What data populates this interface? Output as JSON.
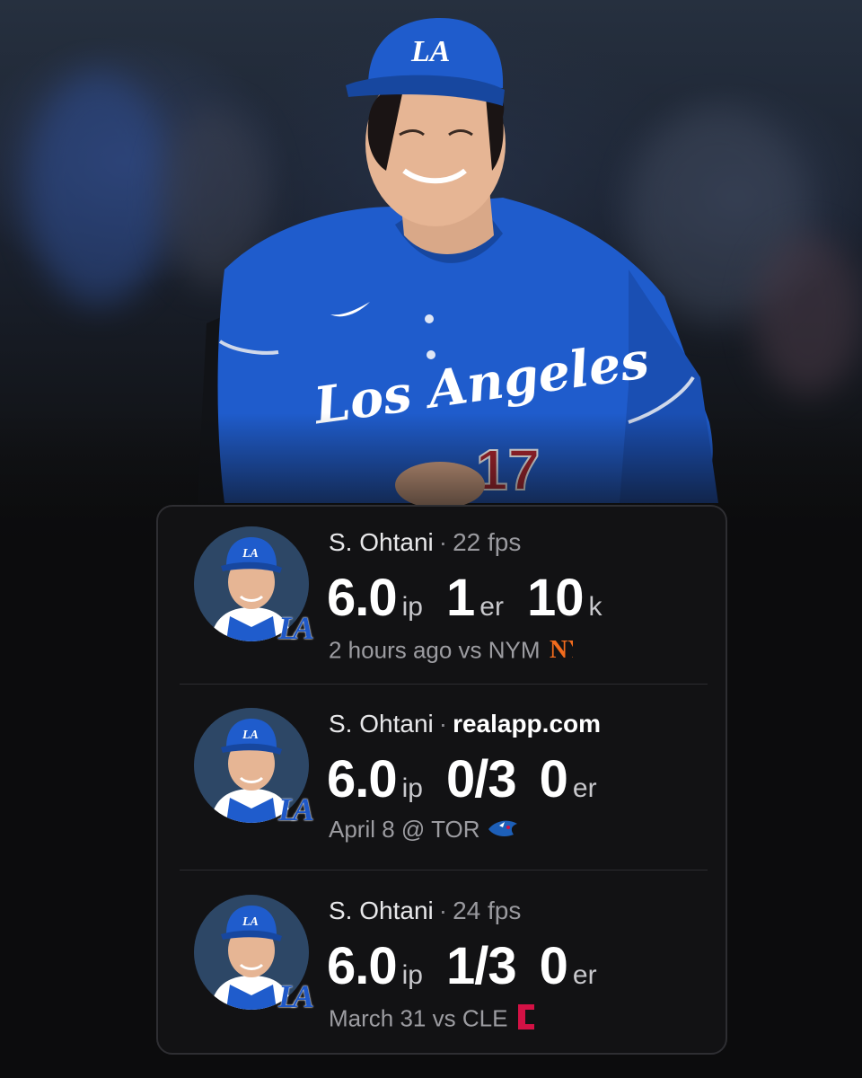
{
  "colors": {
    "dodger_blue": "#1f58c7",
    "card_bg": "#121214",
    "mets_orange": "#f26b1d",
    "guardians_red": "#d31145",
    "bluejays_blue": "#1d5fb8"
  },
  "hero": {
    "jersey_text": "Los Angeles",
    "jersey_number": "17",
    "cap_logo": "LA"
  },
  "games": [
    {
      "player": "S. Ohtani",
      "source": "22 fps",
      "source_style": "muted",
      "stats": [
        {
          "value": "6.0",
          "unit": "ip"
        },
        {
          "value": "1",
          "unit": "er"
        },
        {
          "value": "10",
          "unit": "k"
        }
      ],
      "meta": "2 hours ago vs NYM",
      "team_badge": "LA",
      "opponent_icon": "mets-logo-icon"
    },
    {
      "player": "S. Ohtani",
      "source": "realapp.com",
      "source_style": "strong",
      "stats": [
        {
          "value": "6.0",
          "unit": "ip"
        },
        {
          "value": "0/3",
          "unit": ""
        },
        {
          "value": "0",
          "unit": "er"
        }
      ],
      "meta": "April 8 @ TOR",
      "team_badge": "LA",
      "opponent_icon": "bluejays-logo-icon"
    },
    {
      "player": "S. Ohtani",
      "source": "24 fps",
      "source_style": "muted",
      "stats": [
        {
          "value": "6.0",
          "unit": "ip"
        },
        {
          "value": "1/3",
          "unit": ""
        },
        {
          "value": "0",
          "unit": "er"
        }
      ],
      "meta": "March 31 vs CLE",
      "team_badge": "LA",
      "opponent_icon": "guardians-logo-icon"
    }
  ]
}
